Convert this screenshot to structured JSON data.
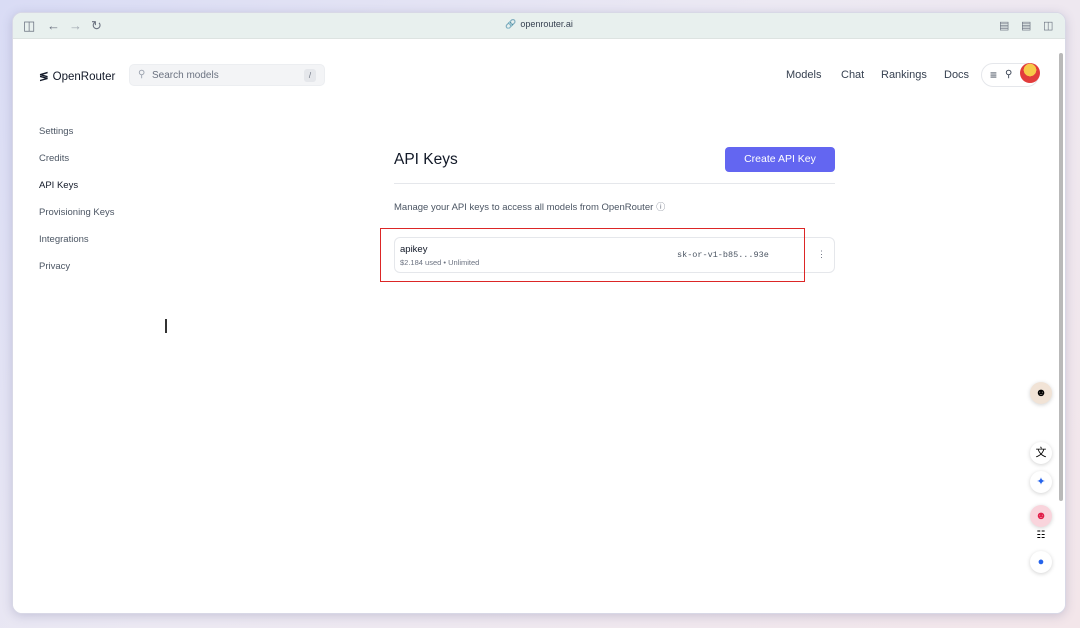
{
  "browser": {
    "url": "openrouter.ai",
    "icons": [
      "sidebar-toggle-icon",
      "back-icon",
      "forward-icon",
      "reload-icon",
      "link-icon",
      "chat-icon",
      "reader-icon",
      "split-view-icon"
    ]
  },
  "header": {
    "logo_mark": "≶",
    "logo_text": "OpenRouter",
    "search": {
      "placeholder": "Search models",
      "shortcut": "/"
    },
    "nav": [
      "Models",
      "Chat",
      "Rankings",
      "Docs"
    ]
  },
  "sidebar": {
    "items": [
      {
        "label": "Settings",
        "active": false
      },
      {
        "label": "Credits",
        "active": false
      },
      {
        "label": "API Keys",
        "active": true
      },
      {
        "label": "Provisioning Keys",
        "active": false
      },
      {
        "label": "Integrations",
        "active": false
      },
      {
        "label": "Privacy",
        "active": false
      }
    ]
  },
  "main": {
    "title": "API Keys",
    "create_button": "Create API Key",
    "description": "Manage your API keys to access all models from OpenRouter",
    "keys": [
      {
        "name": "apikey",
        "meta": "$2.184 used • Unlimited",
        "value": "sk-or-v1-b85...93e"
      }
    ]
  },
  "colors": {
    "accent": "#6366f1",
    "highlight": "#dc2626"
  }
}
